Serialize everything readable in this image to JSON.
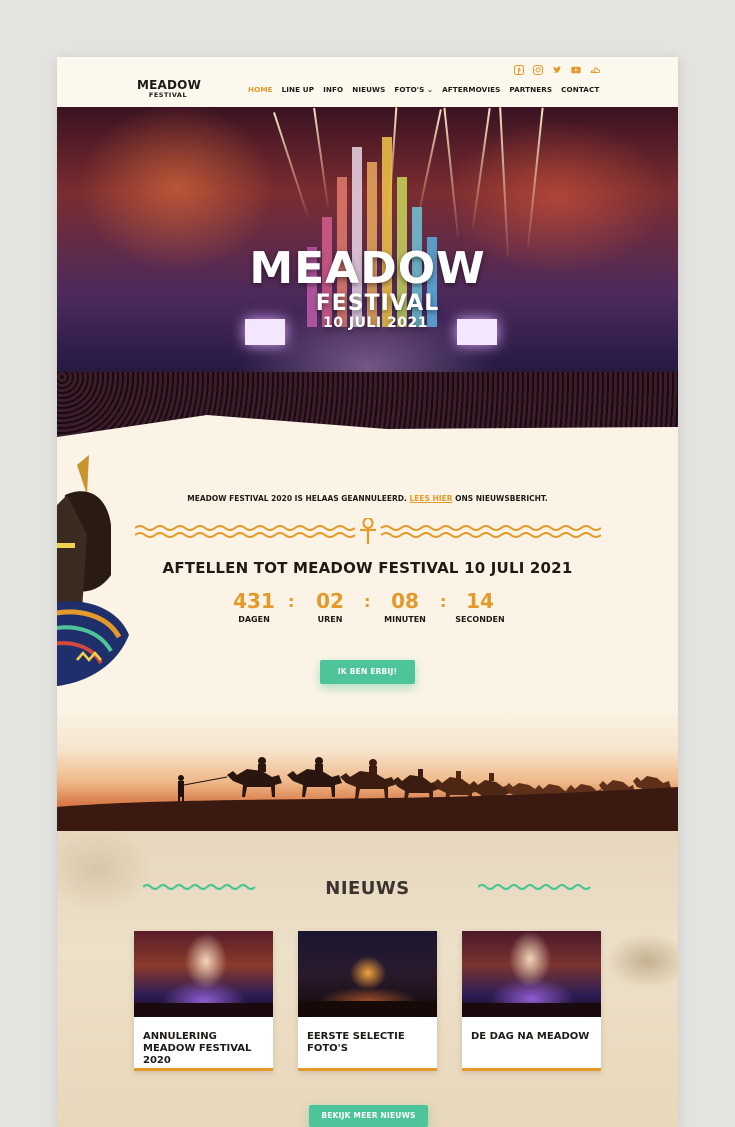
{
  "header": {
    "logo_line1": "MEADOW",
    "logo_line2": "FESTIVAL",
    "social_icons": [
      "facebook-icon",
      "instagram-icon",
      "twitter-icon",
      "youtube-icon",
      "soundcloud-icon"
    ],
    "nav": [
      {
        "label": "HOME",
        "active": true
      },
      {
        "label": "LINE UP",
        "active": false
      },
      {
        "label": "INFO",
        "active": false
      },
      {
        "label": "NIEUWS",
        "active": false
      },
      {
        "label": "FOTO'S ⌄",
        "active": false
      },
      {
        "label": "AFTERMOVIES",
        "active": false
      },
      {
        "label": "PARTNERS",
        "active": false
      },
      {
        "label": "CONTACT",
        "active": false
      }
    ]
  },
  "hero": {
    "title": "MEADOW",
    "subtitle": "FESTIVAL",
    "date": "10 JULI 2021"
  },
  "notice": {
    "text_before": "MEADOW FESTIVAL 2020 IS HELAAS GEANNULEERD. ",
    "link": "LEES HIER",
    "text_after": " ONS NIEUWSBERICHT."
  },
  "countdown": {
    "title": "AFTELLEN TOT MEADOW FESTIVAL 10 JULI 2021",
    "units": [
      {
        "value": "431",
        "label": "DAGEN"
      },
      {
        "value": "02",
        "label": "UREN"
      },
      {
        "value": "08",
        "label": "MINUTEN"
      },
      {
        "value": "14",
        "label": "SECONDEN"
      }
    ],
    "separator": ":",
    "button": "IK BEN ERBIJ!"
  },
  "news": {
    "title": "NIEUWS",
    "cards": [
      {
        "title": "ANNULERING MEADOW FESTIVAL 2020"
      },
      {
        "title": "EERSTE SELECTIE FOTO'S"
      },
      {
        "title": "DE DAG NA MEADOW"
      }
    ],
    "more_button": "BEKIJK MEER NIEUWS"
  },
  "colors": {
    "accent_orange": "#e49a2b",
    "accent_green": "#4ec49a",
    "text_dark": "#1e1a17",
    "page_bg": "#fbf4e6"
  }
}
